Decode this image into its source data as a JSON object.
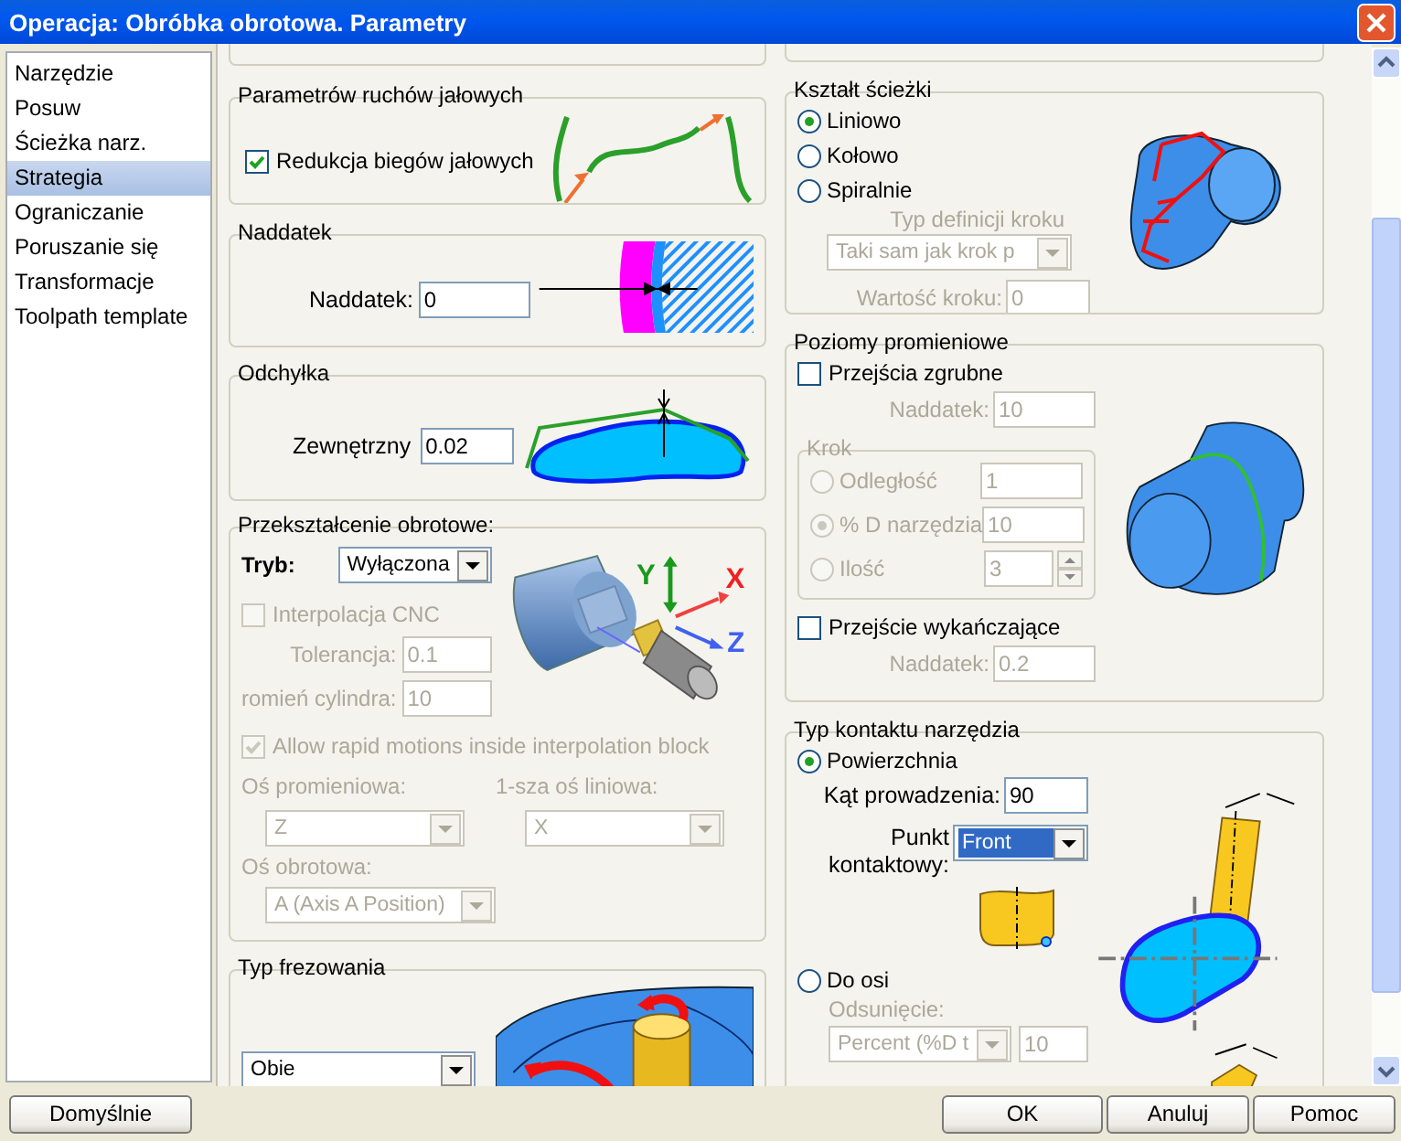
{
  "window": {
    "title": "Operacja: Obróbka obrotowa. Parametry"
  },
  "sidebar": {
    "items": [
      {
        "label": "Narzędzie",
        "selected": false
      },
      {
        "label": "Posuw",
        "selected": false
      },
      {
        "label": "Ścieżka narz.",
        "selected": false
      },
      {
        "label": "Strategia",
        "selected": true
      },
      {
        "label": "Ograniczanie",
        "selected": false
      },
      {
        "label": "Poruszanie się",
        "selected": false
      },
      {
        "label": "Transformacje",
        "selected": false
      },
      {
        "label": "Toolpath template",
        "selected": false
      }
    ]
  },
  "idle_moves": {
    "title": "Parametrów ruchów jałowych",
    "reduce": {
      "label": "Redukcja biegów jałowych",
      "checked": true,
      "disabled": false
    }
  },
  "allowance": {
    "title": "Naddatek",
    "field": {
      "label": "Naddatek:",
      "value": "0",
      "disabled": false
    }
  },
  "deviation": {
    "title": "Odchyłka",
    "field": {
      "label": "Zewnętrzny",
      "value": "0.02",
      "disabled": false
    }
  },
  "rotary_transform": {
    "title": "Przekształcenie obrotowe:",
    "mode": {
      "label": "Tryb:",
      "value": "Wyłączona",
      "disabled": false
    },
    "cnc_interpolation": {
      "label": "Interpolacja CNC",
      "checked": false,
      "disabled": true
    },
    "tolerance": {
      "label": "Tolerancja:",
      "value": "0.1",
      "disabled": true
    },
    "cylinder_radius": {
      "label": "romień cylindra:",
      "value": "10",
      "disabled": true
    },
    "rapid_motions": {
      "label": "Allow rapid motions inside interpolation block",
      "checked": true,
      "disabled": true
    },
    "radial_axis": {
      "label": "Oś promieniowa:",
      "value": "Z",
      "disabled": true
    },
    "linear_axis": {
      "label": "1-sza oś liniowa:",
      "value": "X",
      "disabled": true
    },
    "rotary_axis": {
      "label": "Oś obrotowa:",
      "value": "A (Axis A Position)",
      "disabled": true
    },
    "axis_labels": [
      "Y",
      "X",
      "Z"
    ]
  },
  "milling_type": {
    "title": "Typ frezowania",
    "mode": {
      "value": "Obie",
      "disabled": false
    }
  },
  "path_shape": {
    "title": "Kształt ścieżki",
    "options": [
      {
        "label": "Liniowo",
        "selected": true,
        "disabled": false
      },
      {
        "label": "Kołowo",
        "selected": false,
        "disabled": false
      },
      {
        "label": "Spiralnie",
        "selected": false,
        "disabled": false
      }
    ],
    "step_type": {
      "label": "Typ definicji kroku",
      "value": "Taki sam jak krok p",
      "disabled": true
    },
    "step_value": {
      "label": "Wartość kroku:",
      "value": "0",
      "disabled": true
    }
  },
  "radial_levels": {
    "title": "Poziomy promieniowe",
    "roughing": {
      "label": "Przejścia zgrubne",
      "checked": false,
      "disabled": false
    },
    "roughing_allowance": {
      "label": "Naddatek:",
      "value": "10",
      "disabled": true
    },
    "step": {
      "title": "Krok",
      "disabled": true,
      "options": [
        {
          "kind": "field",
          "label": "Odległość",
          "selected": false,
          "value": "1"
        },
        {
          "kind": "field",
          "label": "% D narzędzia",
          "selected": true,
          "value": "10"
        },
        {
          "kind": "spin",
          "label": "Ilość",
          "selected": false,
          "value": "3"
        }
      ]
    },
    "finishing": {
      "label": "Przejście wykańczające",
      "checked": false,
      "disabled": false
    },
    "finishing_allowance": {
      "label": "Naddatek:",
      "value": "0.2",
      "disabled": true
    }
  },
  "tool_contact": {
    "title": "Typ kontaktu narzędzia",
    "surface": {
      "label": "Powierzchnia",
      "selected": true,
      "disabled": false
    },
    "lead_angle": {
      "label": "Kąt prowadzenia:",
      "value": "90",
      "disabled": false
    },
    "contact_point": {
      "label": "Punkt kontaktowy:",
      "value": "Front",
      "highlighted": true,
      "disabled": false
    },
    "axis": {
      "label": "Do osi",
      "selected": false,
      "disabled": false
    },
    "offset": {
      "label": "Odsunięcie:",
      "value": "Percent (%D t",
      "amount": "10",
      "disabled": true
    }
  },
  "buttons": [
    {
      "label": "Domyślnie"
    },
    {
      "label": "OK"
    },
    {
      "label": "Anuluj"
    },
    {
      "label": "Pomoc"
    }
  ]
}
